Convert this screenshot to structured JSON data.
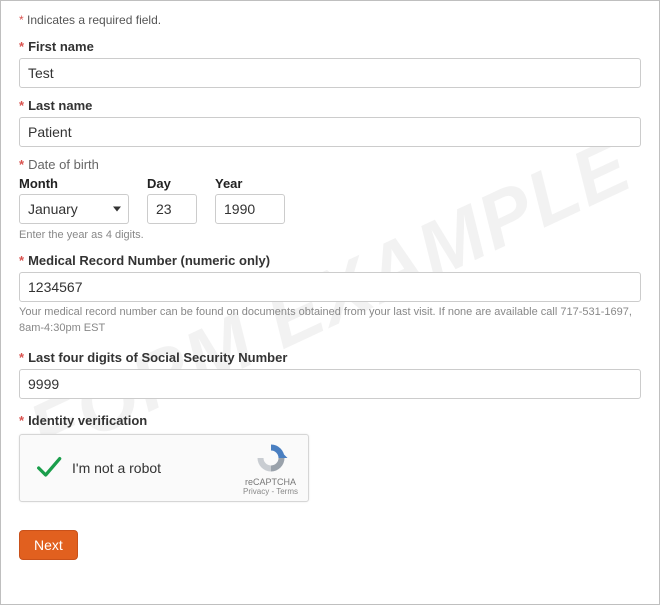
{
  "watermark": "FORM EXAMPLE",
  "required_note": {
    "prefix": "*",
    "text": " Indicates a required field."
  },
  "fields": {
    "first_name": {
      "label": "First name",
      "value": "Test"
    },
    "last_name": {
      "label": "Last name",
      "value": "Patient"
    },
    "dob": {
      "label": "Date of birth",
      "month_label": "Month",
      "day_label": "Day",
      "year_label": "Year",
      "month_value": "January",
      "day_value": "23",
      "year_value": "1990",
      "hint": "Enter the year as 4 digits."
    },
    "mrn": {
      "label": "Medical Record Number (numeric only)",
      "value": "1234567",
      "hint": "Your medical record number can be found on documents obtained from your last visit. If none are available call 717-531-1697, 8am-4:30pm EST"
    },
    "ssn": {
      "label": "Last four digits of Social Security Number",
      "value": "9999"
    },
    "identity": {
      "label": "Identity verification"
    }
  },
  "captcha": {
    "label": "I'm not a robot",
    "brand": "reCAPTCHA",
    "links": "Privacy - Terms",
    "checked": true
  },
  "buttons": {
    "next": "Next"
  }
}
